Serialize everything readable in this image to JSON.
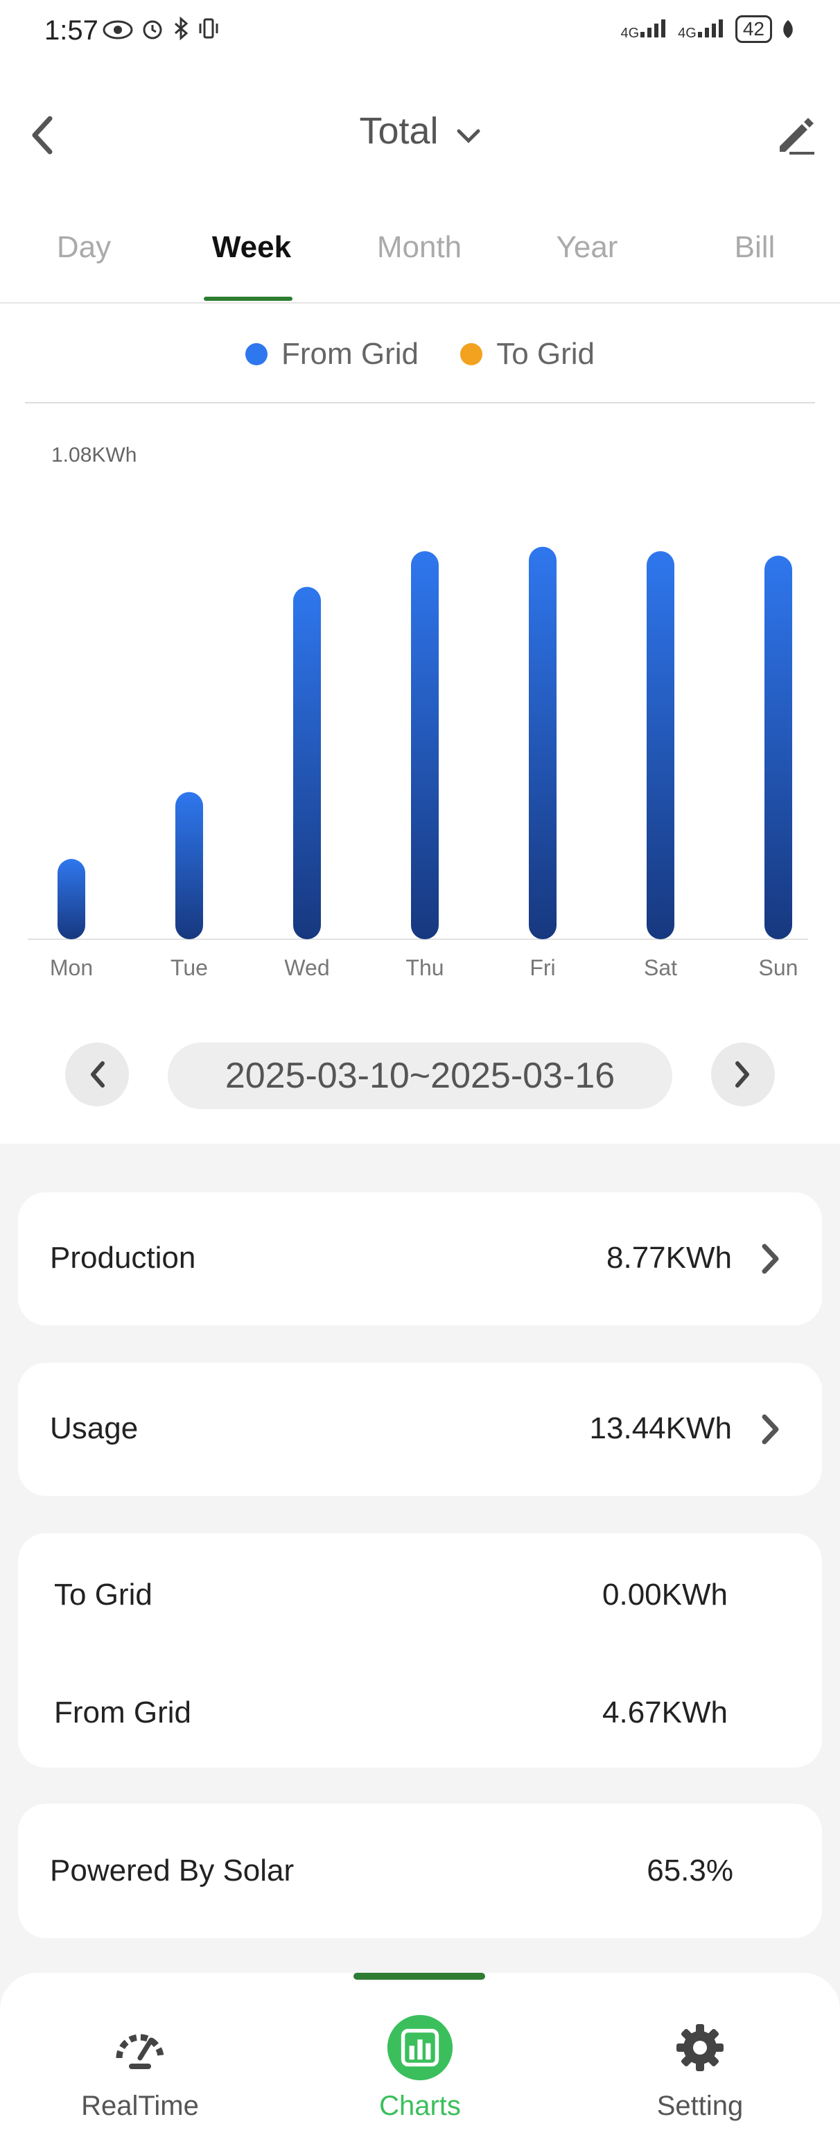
{
  "status_bar": {
    "time": "1:57",
    "battery": "42",
    "signal_1": "4G",
    "signal_2": "4G"
  },
  "header": {
    "title": "Total",
    "back_icon": "chevron-left-icon",
    "edit_icon": "pencil-icon"
  },
  "tabs": [
    {
      "label": "Day"
    },
    {
      "label": "Week"
    },
    {
      "label": "Month"
    },
    {
      "label": "Year"
    },
    {
      "label": "Bill"
    }
  ],
  "active_tab": "Week",
  "legend": [
    {
      "label": "From Grid",
      "color": "#2f77ee"
    },
    {
      "label": "To Grid",
      "color": "#f2a21f"
    }
  ],
  "chart_data": {
    "type": "bar",
    "y_max_label": "1.08KWh",
    "ylim": [
      0,
      1.08
    ],
    "categories": [
      "Mon",
      "Tue",
      "Wed",
      "Thu",
      "Fri",
      "Sat",
      "Sun"
    ],
    "series": [
      {
        "name": "From Grid",
        "values": [
          0.18,
          0.33,
          0.79,
          0.87,
          0.88,
          0.87,
          0.86
        ],
        "color": "#2f77ee"
      },
      {
        "name": "To Grid",
        "values": [
          0,
          0,
          0,
          0,
          0,
          0,
          0
        ],
        "color": "#f2a21f"
      }
    ]
  },
  "period": {
    "range": "2025-03-10~2025-03-16"
  },
  "summary": {
    "production_label": "Production",
    "production_value": "8.77KWh",
    "usage_label": "Usage",
    "usage_value": "13.44KWh",
    "to_grid_label": "To Grid",
    "to_grid_value": "0.00KWh",
    "from_grid_label": "From Grid",
    "from_grid_value": "4.67KWh",
    "solar_label": "Powered By Solar",
    "solar_value": "65.3%"
  },
  "bottom_nav": [
    {
      "label": "RealTime",
      "icon": "gauge-icon"
    },
    {
      "label": "Charts",
      "icon": "bar-chart-icon"
    },
    {
      "label": "Setting",
      "icon": "gear-icon"
    }
  ],
  "colors": {
    "accent_green": "#2e7d32",
    "nav_active": "#3bbf5c",
    "bar_top": "#2f77ee",
    "bar_bottom": "#17387f"
  }
}
